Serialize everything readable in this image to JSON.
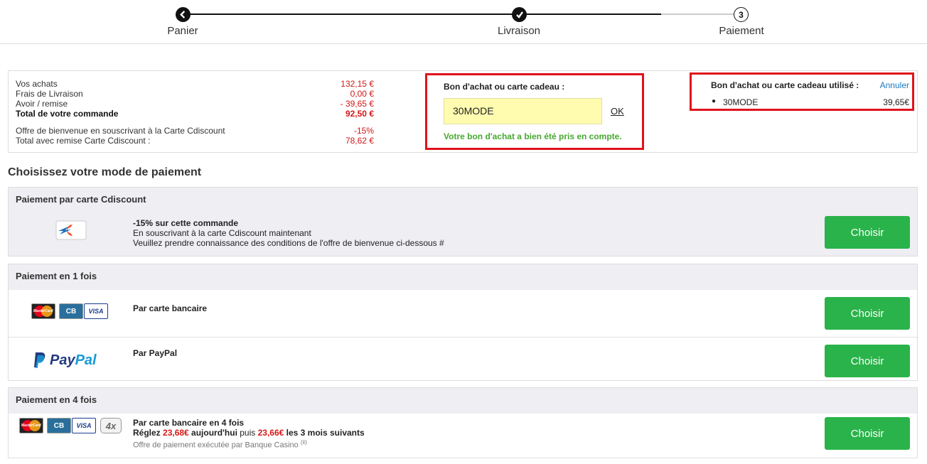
{
  "stepper": {
    "steps": [
      {
        "label": "Panier",
        "state": "done"
      },
      {
        "label": "Livraison",
        "state": "done"
      },
      {
        "label": "Paiement",
        "state": "current",
        "number": "3"
      }
    ]
  },
  "summary": {
    "rows": [
      {
        "label": "Vos achats",
        "value": "132,15 €"
      },
      {
        "label": "Frais de Livraison",
        "value": "0,00 €"
      },
      {
        "label": "Avoir / remise",
        "value": "- 39,65 €"
      },
      {
        "label": "Total de votre commande",
        "value": "92,50 €"
      },
      {
        "label": "Offre de bienvenue en souscrivant à la Carte Cdiscount",
        "value": "-15%"
      },
      {
        "label": "Total avec remise Carte Cdiscount :",
        "value": "78,62 €"
      }
    ]
  },
  "voucher": {
    "title": "Bon d'achat ou carte cadeau :",
    "input_value": "30MODE",
    "ok_label": "OK",
    "success_message": "Votre bon d'achat a bien été pris en compte."
  },
  "used_voucher": {
    "title": "Bon d'achat ou carte cadeau utilisé :",
    "cancel_label": "Annuler",
    "code": "30MODE",
    "amount": "39,65€"
  },
  "payment": {
    "section_title": "Choisissez votre mode de paiement",
    "choose_label": "Choisir",
    "cdiscount": {
      "header": "Paiement par carte Cdiscount",
      "line1": "-15% sur cette commande",
      "line2": "En souscrivant à la carte Cdiscount maintenant",
      "line3": "Veuillez prendre connaissance des conditions de l'offre de bienvenue ci-dessous #"
    },
    "once": {
      "header": "Paiement en 1 fois",
      "card_label": "Par carte bancaire",
      "paypal_label": "Par PayPal",
      "paypal_logo_a": "Pay",
      "paypal_logo_b": "Pal"
    },
    "four": {
      "header": "Paiement en 4 fois",
      "line1": "Par carte bancaire en 4 fois",
      "line2_a": "Réglez ",
      "amount_first": "23,68€",
      "line2_b": " aujourd'hui",
      "line2_c": " puis ",
      "amount_next": "23,66€",
      "line2_d": " les 3 mois suivants",
      "note": "Offre de paiement exécutée par Banque Casino",
      "note_sup": "(ii)",
      "badge_4x": "4x"
    },
    "card_logos": {
      "mastercard": "MasterCard",
      "cb": "CB",
      "visa": "VISA"
    }
  }
}
